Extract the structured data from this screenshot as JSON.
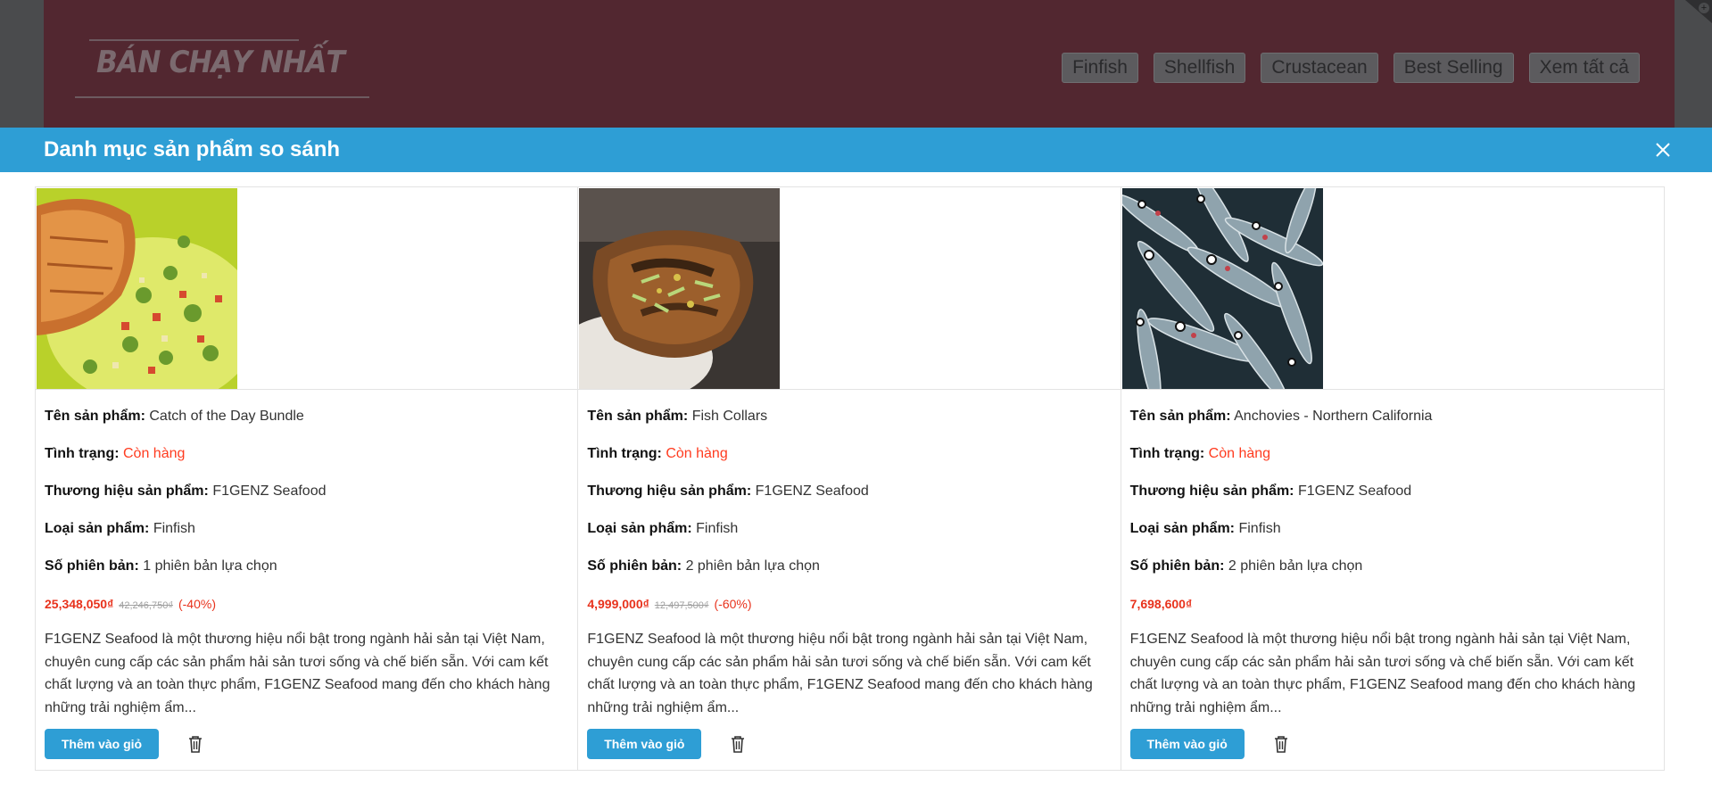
{
  "background": {
    "logo_text": "BÁN CHẠY NHẤT",
    "tabs": [
      "Finfish",
      "Shellfish",
      "Crustacean",
      "Best Selling",
      "Xem tất cả"
    ],
    "band_color": "#522730"
  },
  "modal": {
    "title": "Danh mục sản phẩm so sánh",
    "close_icon": "close-icon",
    "header_color": "#2e9ed5"
  },
  "labels": {
    "name": "Tên sản phẩm:",
    "status": "Tình trạng:",
    "brand": "Thương hiệu sản phẩm:",
    "type": "Loại sản phẩm:",
    "variants": "Số phiên bản:",
    "add_to_cart": "Thêm vào giỏ"
  },
  "products": [
    {
      "name": "Catch of the Day Bundle",
      "status": "Còn hàng",
      "brand": "F1GENZ Seafood",
      "type": "Finfish",
      "variants": "1 phiên bản lựa chọn",
      "price": "25,348,050₫",
      "old_price": "42,246,750₫",
      "discount": "(-40%)",
      "description": "F1GENZ Seafood là một thương hiệu nổi bật trong ngành hải sản tại Việt Nam, chuyên cung cấp các sản phẩm hải sản tươi sống và chế biến sẵn. Với cam kết chất lượng và an toàn thực phẩm, F1GENZ Seafood mang đến cho khách hàng những trải nghiệm ẩm..."
    },
    {
      "name": "Fish Collars",
      "status": "Còn hàng",
      "brand": "F1GENZ Seafood",
      "type": "Finfish",
      "variants": "2 phiên bản lựa chọn",
      "price": "4,999,000₫",
      "old_price": "12,497,500₫",
      "discount": "(-60%)",
      "description": "F1GENZ Seafood là một thương hiệu nổi bật trong ngành hải sản tại Việt Nam, chuyên cung cấp các sản phẩm hải sản tươi sống và chế biến sẵn. Với cam kết chất lượng và an toàn thực phẩm, F1GENZ Seafood mang đến cho khách hàng những trải nghiệm ẩm..."
    },
    {
      "name": "Anchovies - Northern California",
      "status": "Còn hàng",
      "brand": "F1GENZ Seafood",
      "type": "Finfish",
      "variants": "2 phiên bản lựa chọn",
      "price": "7,698,600₫",
      "old_price": "",
      "discount": "",
      "description": "F1GENZ Seafood là một thương hiệu nổi bật trong ngành hải sản tại Việt Nam, chuyên cung cấp các sản phẩm hải sản tươi sống và chế biến sẵn. Với cam kết chất lượng và an toàn thực phẩm, F1GENZ Seafood mang đến cho khách hàng những trải nghiệm ẩm..."
    }
  ]
}
